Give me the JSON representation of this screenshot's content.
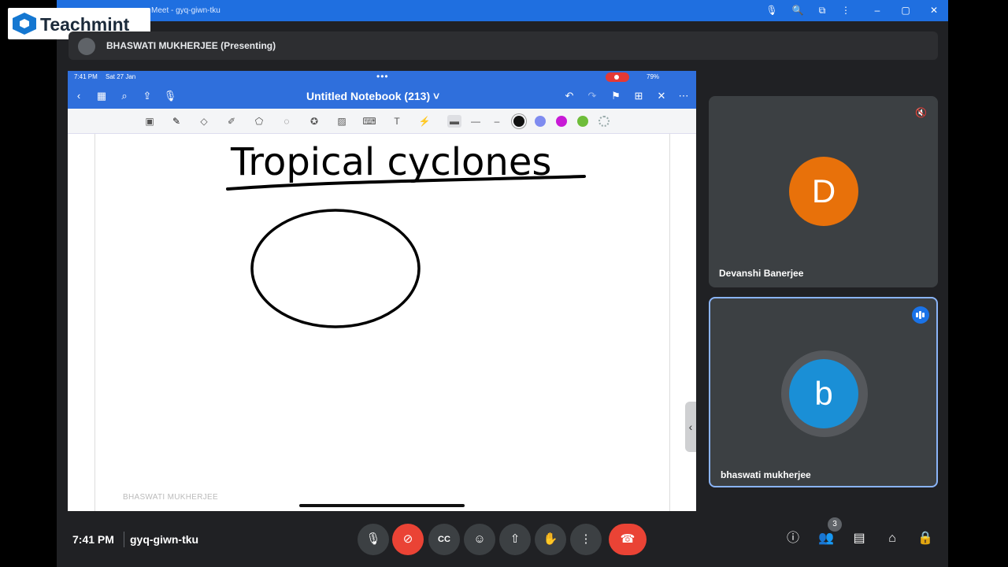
{
  "browser": {
    "tab_title": "Meet - gyq-giwn-tku"
  },
  "logo": {
    "name": "Teachmint"
  },
  "presenter_bar": {
    "text": "BHASWATI MUKHERJEE (Presenting)"
  },
  "ipad": {
    "time": "7:41 PM",
    "date": "Sat 27 Jan",
    "battery": "79%",
    "notebook_title": "Untitled Notebook (213) ˅",
    "watermark": "BHASWATI MUKHERJEE",
    "colors": {
      "black": "#111111",
      "periwinkle": "#7f8cf0",
      "magenta": "#c81ad6",
      "green": "#6ebd3a",
      "accent": "#2f6fdc"
    },
    "handwritten_title": "Tropical cyclones"
  },
  "participants": [
    {
      "name": "Devanshi Banerjee",
      "initial": "D",
      "color": "#e8710a"
    },
    {
      "name": "bhaswati mukherjee",
      "initial": "b",
      "color": "#1a8fd6"
    }
  ],
  "bottom": {
    "time": "7:41 PM",
    "meeting_code": "gyq-giwn-tku",
    "participant_count": "3"
  }
}
